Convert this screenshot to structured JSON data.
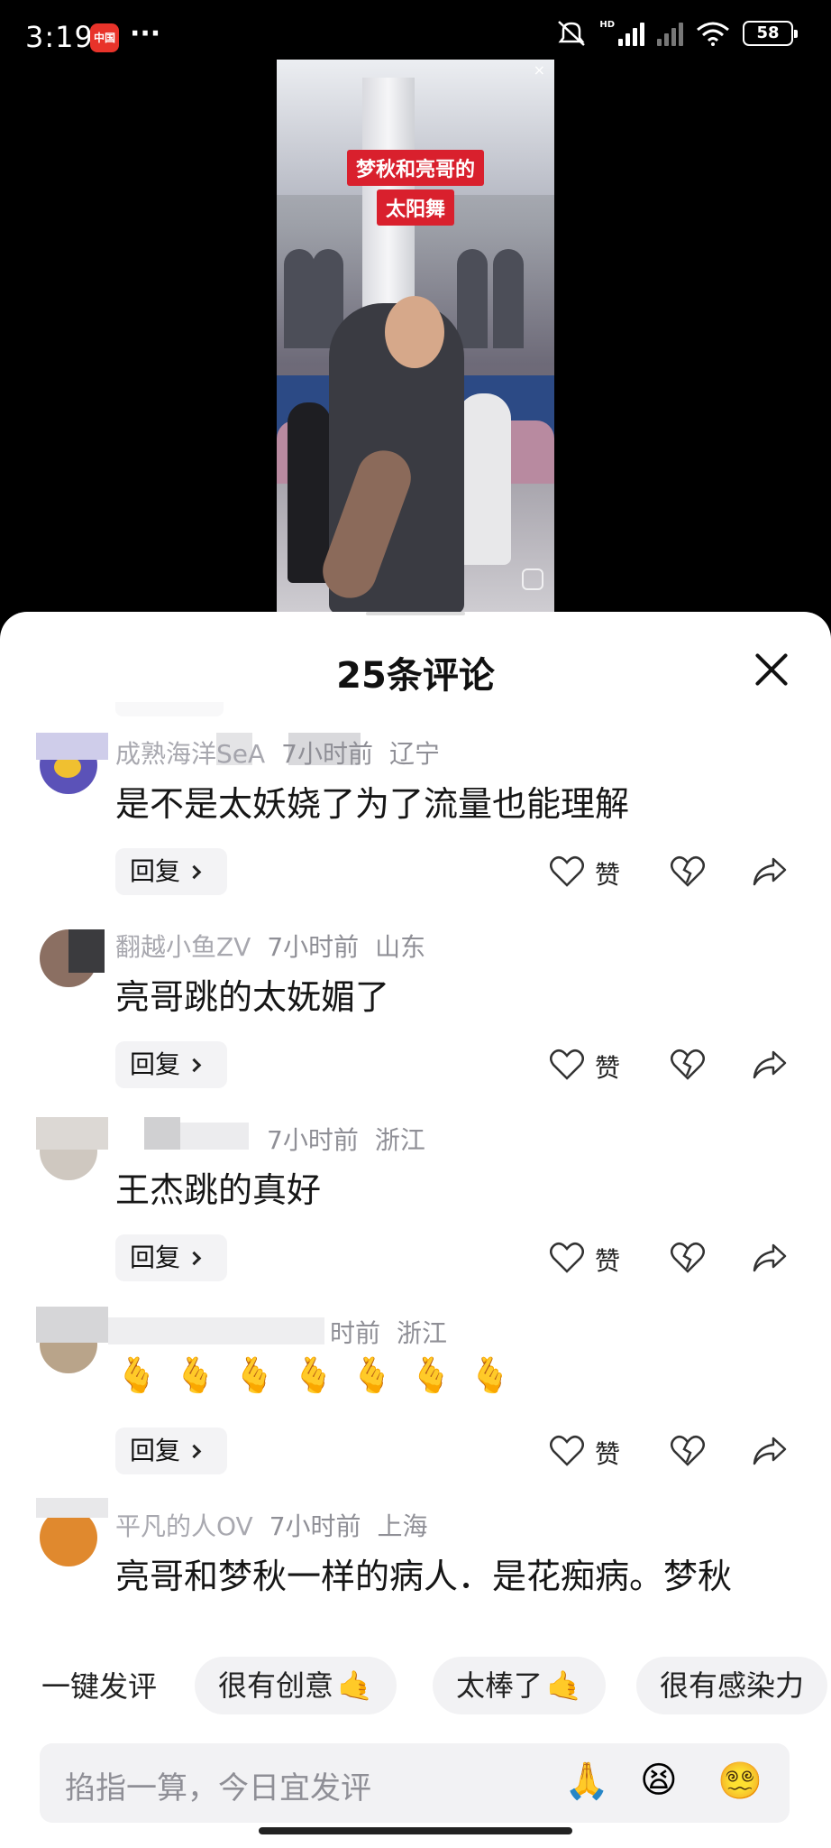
{
  "status_bar": {
    "time": "3:19",
    "app_badge": "中国",
    "dots": "···",
    "hd": "HD",
    "battery": "58"
  },
  "video": {
    "caption_line1": "梦秋和亮哥的",
    "caption_line2": "太阳舞",
    "close": "×"
  },
  "sheet": {
    "title": "25条评论"
  },
  "comments": [
    {
      "name": "成熟海洋SeA",
      "time": "7小时前",
      "region": "辽宁",
      "text": "是不是太妖娆了为了流量也能理解",
      "reply": "回复",
      "like": "赞"
    },
    {
      "name": "翻越小鱼ZV",
      "time": "7小时前",
      "region": "山东",
      "text": "亮哥跳的太妩媚了",
      "reply": "回复",
      "like": "赞"
    },
    {
      "name": "",
      "time": "7小时前",
      "region": "浙江",
      "text": "王杰跳的真好",
      "reply": "回复",
      "like": "赞"
    },
    {
      "name": "",
      "time": "时前",
      "region": "浙江",
      "emoji": [
        "🫰",
        "🫰",
        "🫰",
        "🫰",
        "🫰",
        "🫰",
        "🫰"
      ],
      "reply": "回复",
      "like": "赞"
    },
    {
      "name": "平凡的人OV",
      "time": "7小时前",
      "region": "上海",
      "text": "亮哥和梦秋一样的病人．是花痴病。梦秋"
    }
  ],
  "quick_comment": {
    "label": "一键发评",
    "chips": [
      "很有创意",
      "太棒了",
      "很有感染力"
    ],
    "chip_emoji": "🤙"
  },
  "input": {
    "placeholder": "掐指一算，今日宜发评",
    "emojis": [
      "🙏",
      "😫",
      "😵‍💫"
    ]
  },
  "colors": {
    "caption_red": "#d9202d",
    "sheet_bg": "#ffffff",
    "chip_bg": "#f2f2f4"
  }
}
